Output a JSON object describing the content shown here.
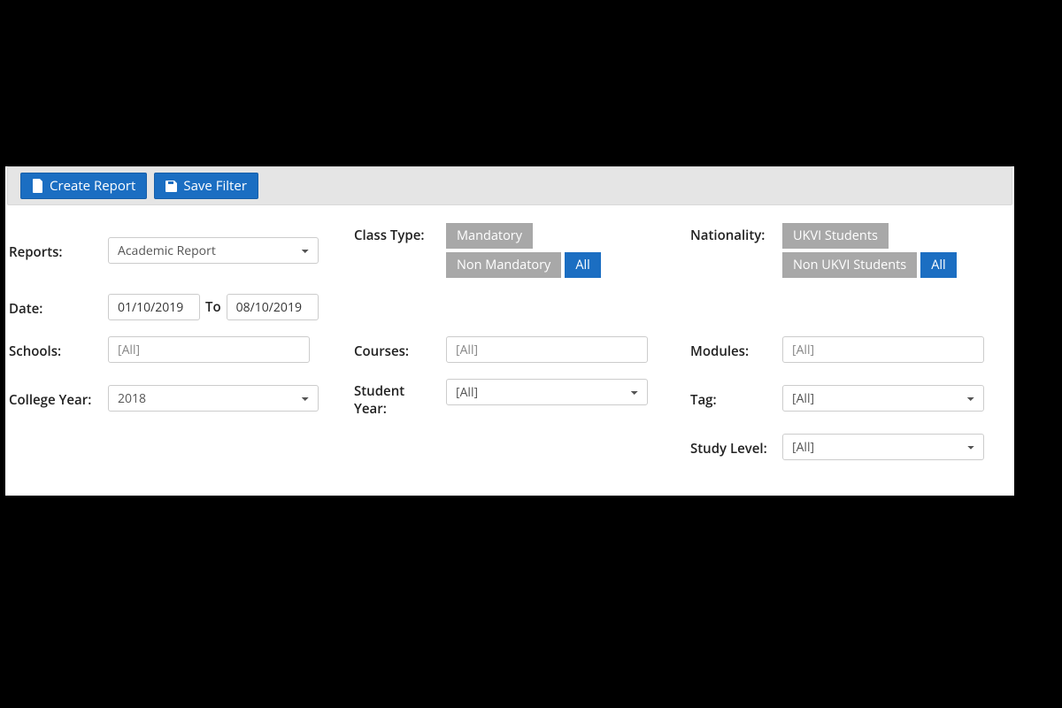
{
  "toolbar": {
    "create_report": "Create Report",
    "save_filter": "Save Filter"
  },
  "labels": {
    "reports": "Reports:",
    "class_type": "Class Type:",
    "nationality": "Nationality:",
    "date": "Date:",
    "to": "To",
    "schools": "Schools:",
    "courses": "Courses:",
    "modules": "Modules:",
    "college_year": "College Year:",
    "student_year": "Student Year:",
    "tag": "Tag:",
    "study_level": "Study Level:"
  },
  "values": {
    "reports": "Academic Report",
    "date_from": "01/10/2019",
    "date_to": "08/10/2019",
    "schools": "[All]",
    "courses": "[All]",
    "modules": "[All]",
    "college_year": "2018",
    "student_year": "[All]",
    "tag": "[All]",
    "study_level": "[All]"
  },
  "class_type": {
    "mandatory": "Mandatory",
    "non_mandatory": "Non Mandatory",
    "all": "All"
  },
  "nationality": {
    "ukvi": "UKVI Students",
    "non_ukvi": "Non UKVI Students",
    "all": "All"
  },
  "colors": {
    "primary": "#1b6ec2",
    "inactive": "#a8a8a8"
  }
}
